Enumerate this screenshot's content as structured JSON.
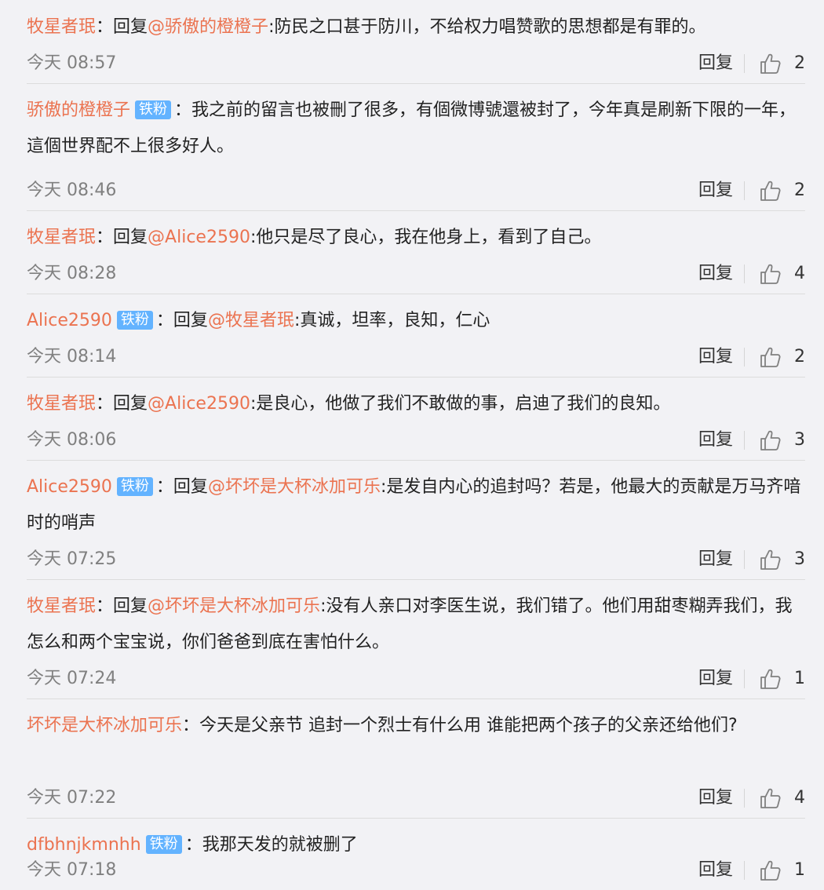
{
  "reply_label": "回复",
  "colon": "：",
  "comments": [
    {
      "user": "牧星者珉",
      "badge": null,
      "reply_prefix": "回复",
      "mention": "@骄傲的橙橙子",
      "rest": ":防民之口甚于防川，不给权力唱赞歌的思想都是有罪的。",
      "time": "今天 08:57",
      "likes": "2"
    },
    {
      "user": "骄傲的橙橙子",
      "badge": "铁粉",
      "reply_prefix": "",
      "mention": "",
      "rest": "我之前的留言也被刪了很多，有個微博號還被封了，今年真是刷新下限的一年，這個世界配不上很多好人。",
      "time": "今天 08:46",
      "likes": "2"
    },
    {
      "user": "牧星者珉",
      "badge": null,
      "reply_prefix": "回复",
      "mention": "@Alice2590",
      "rest": ":他只是尽了良心，我在他身上，看到了自己。",
      "time": "今天 08:28",
      "likes": "4"
    },
    {
      "user": "Alice2590",
      "badge": "铁粉",
      "reply_prefix": "回复",
      "mention": "@牧星者珉",
      "rest": ":真诚，坦率，良知，仁心",
      "time": "今天 08:14",
      "likes": "2"
    },
    {
      "user": "牧星者珉",
      "badge": null,
      "reply_prefix": "回复",
      "mention": "@Alice2590",
      "rest": ":是良心，他做了我们不敢做的事，启迪了我们的良知。",
      "time": "今天 08:06",
      "likes": "3"
    },
    {
      "user": "Alice2590",
      "badge": "铁粉",
      "reply_prefix": "回复",
      "mention": "@坏坏是大杯冰加可乐",
      "rest": ":是发自内心的追封吗？若是，他最大的贡献是万马齐喑时的哨声",
      "time": "今天 07:25",
      "likes": "3"
    },
    {
      "user": "牧星者珉",
      "badge": null,
      "reply_prefix": "回复",
      "mention": "@坏坏是大杯冰加可乐",
      "rest": ":没有人亲口对李医生说，我们错了。他们用甜枣糊弄我们，我怎么和两个宝宝说，你们爸爸到底在害怕什么。",
      "time": "今天 07:24",
      "likes": "1"
    },
    {
      "user": "坏坏是大杯冰加可乐",
      "badge": null,
      "reply_prefix": "",
      "mention": "",
      "rest": "今天是父亲节 追封一个烈士有什么用 谁能把两个孩子的父亲还给他们?",
      "time": "今天 07:22",
      "likes": "4"
    },
    {
      "user": "dfbhnjkmnhh",
      "badge": "铁粉",
      "reply_prefix": "",
      "mention": "",
      "rest": "我那天发的就被删了",
      "time": "今天 07:18",
      "likes": "1"
    }
  ]
}
